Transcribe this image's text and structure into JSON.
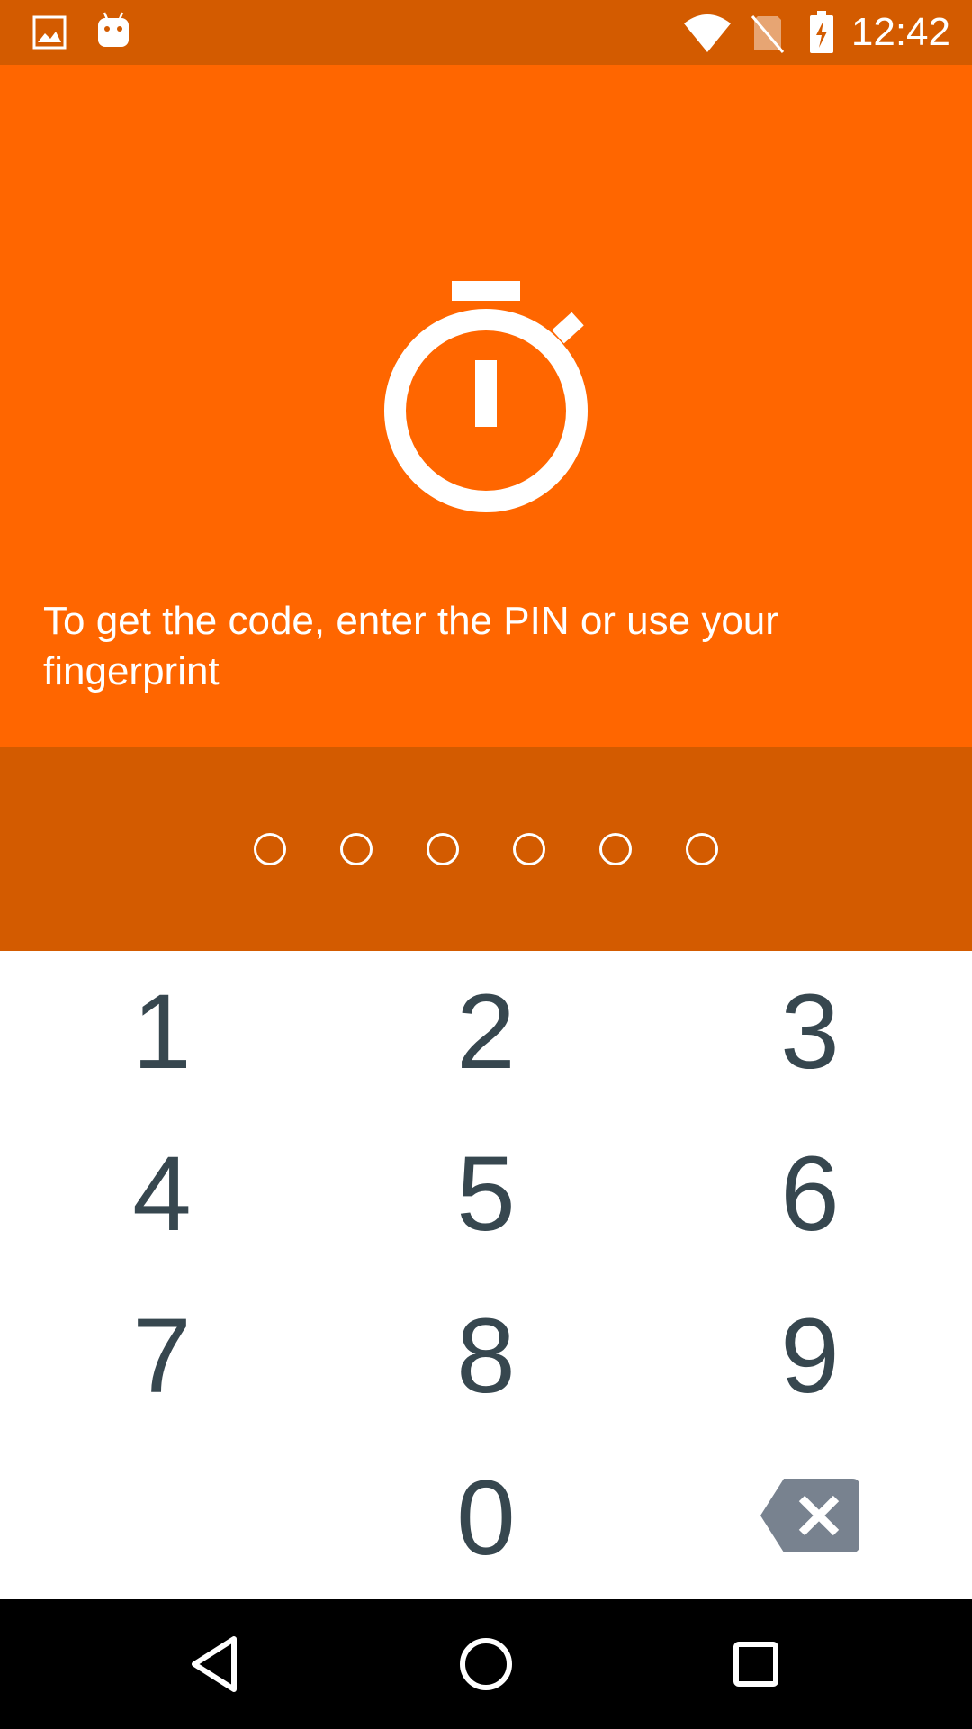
{
  "status_bar": {
    "time": "12:42",
    "left_icons": [
      "image-icon",
      "android-icon"
    ],
    "right_icons": [
      "wifi-icon",
      "no-sim-icon",
      "battery-charging-icon"
    ],
    "background": "#d35b00"
  },
  "hero": {
    "icon": "timer-icon",
    "message": "To get the code, enter the PIN or use your fingerprint",
    "background": "#ff6600"
  },
  "pin": {
    "length": 6,
    "entered": 0,
    "background": "#d35b00"
  },
  "keypad": {
    "keys": [
      {
        "label": "1"
      },
      {
        "label": "2"
      },
      {
        "label": "3"
      },
      {
        "label": "4"
      },
      {
        "label": "5"
      },
      {
        "label": "6"
      },
      {
        "label": "7"
      },
      {
        "label": "8"
      },
      {
        "label": "9"
      },
      {
        "label": "0"
      }
    ],
    "backspace_icon": "backspace-icon",
    "digit_color": "#37474f"
  },
  "nav_bar": {
    "buttons": [
      "back-icon",
      "home-icon",
      "recents-icon"
    ]
  }
}
